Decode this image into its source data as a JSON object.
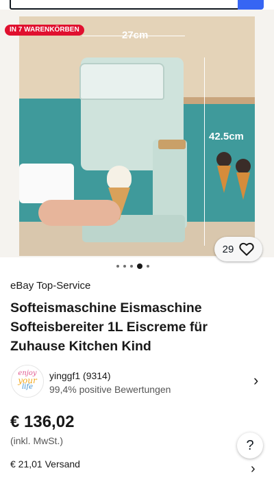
{
  "gallery": {
    "badge": "IN 7 WARENKÖRBEN",
    "dimension_width": "27cm",
    "dimension_height": "42.5cm",
    "watch_count": "29",
    "image_count": 5,
    "active_image": 4
  },
  "product": {
    "service_label": "eBay Top-Service",
    "title": "Softeismaschine Eismaschine Softeisbereiter 1L Eiscreme für Zuhause Kitchen Kind",
    "price": "€ 136,02",
    "tax_note": "(inkl. MwSt.)",
    "shipping": "€ 21,01 Versand"
  },
  "seller": {
    "name": "yinggf1 (9314)",
    "rating": "99,4% positive Bewertungen",
    "avatar_text": [
      "enjoy",
      "your",
      "life"
    ]
  },
  "icons": {
    "watch": "heart-icon",
    "seller_chevron": "chevron-right-icon",
    "help": "question-icon"
  },
  "colors": {
    "accent": "#3665f3",
    "badge": "#e0102f"
  }
}
